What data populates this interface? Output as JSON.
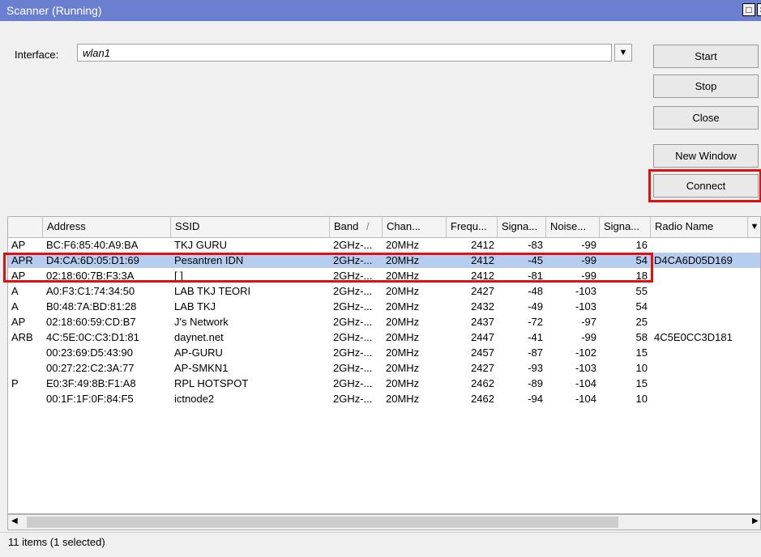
{
  "window": {
    "title": "Scanner (Running)"
  },
  "interface": {
    "label": "Interface:",
    "value": "wlan1"
  },
  "buttons": {
    "start": "Start",
    "stop": "Stop",
    "close": "Close",
    "new_window": "New Window",
    "connect": "Connect"
  },
  "table": {
    "columns": [
      "",
      "Address",
      "SSID",
      "Band",
      "Chan...",
      "Frequ...",
      "Signa...",
      "Noise...",
      "Signa...",
      "Radio Name"
    ],
    "sort_indicator": "/",
    "rows": [
      {
        "flags": "AP",
        "address": "BC:F6:85:40:A9:BA",
        "ssid": "TKJ GURU",
        "band": "2GHz-...",
        "channel": "20MHz",
        "freq": "2412",
        "signal": "-83",
        "noise": "-99",
        "snr": "16",
        "radio": ""
      },
      {
        "flags": "APR",
        "address": "D4:CA:6D:05:D1:69",
        "ssid": "Pesantren IDN",
        "band": "2GHz-...",
        "channel": "20MHz",
        "freq": "2412",
        "signal": "-45",
        "noise": "-99",
        "snr": "54",
        "radio": "D4CA6D05D169",
        "selected": true
      },
      {
        "flags": "AP",
        "address": "02:18:60:7B:F3:3A",
        "ssid": "[ ]",
        "band": "2GHz-...",
        "channel": "20MHz",
        "freq": "2412",
        "signal": "-81",
        "noise": "-99",
        "snr": "18",
        "radio": ""
      },
      {
        "flags": "A",
        "address": "A0:F3:C1:74:34:50",
        "ssid": "LAB TKJ TEORI",
        "band": "2GHz-...",
        "channel": "20MHz",
        "freq": "2427",
        "signal": "-48",
        "noise": "-103",
        "snr": "55",
        "radio": ""
      },
      {
        "flags": "A",
        "address": "B0:48:7A:BD:81:28",
        "ssid": "LAB TKJ",
        "band": "2GHz-...",
        "channel": "20MHz",
        "freq": "2432",
        "signal": "-49",
        "noise": "-103",
        "snr": "54",
        "radio": ""
      },
      {
        "flags": "AP",
        "address": "02:18:60:59:CD:B7",
        "ssid": "J's Network",
        "band": "2GHz-...",
        "channel": "20MHz",
        "freq": "2437",
        "signal": "-72",
        "noise": "-97",
        "snr": "25",
        "radio": ""
      },
      {
        "flags": "ARB",
        "address": "4C:5E:0C:C3:D1:81",
        "ssid": "daynet.net",
        "band": "2GHz-...",
        "channel": "20MHz",
        "freq": "2447",
        "signal": "-41",
        "noise": "-99",
        "snr": "58",
        "radio": "4C5E0CC3D181"
      },
      {
        "flags": "",
        "address": "00:23:69:D5:43:90",
        "ssid": "AP-GURU",
        "band": "2GHz-...",
        "channel": "20MHz",
        "freq": "2457",
        "signal": "-87",
        "noise": "-102",
        "snr": "15",
        "radio": ""
      },
      {
        "flags": "",
        "address": "00:27:22:C2:3A:77",
        "ssid": "AP-SMKN1",
        "band": "2GHz-...",
        "channel": "20MHz",
        "freq": "2427",
        "signal": "-93",
        "noise": "-103",
        "snr": "10",
        "radio": ""
      },
      {
        "flags": "P",
        "address": "E0:3F:49:8B:F1:A8",
        "ssid": "RPL HOTSPOT",
        "band": "2GHz-...",
        "channel": "20MHz",
        "freq": "2462",
        "signal": "-89",
        "noise": "-104",
        "snr": "15",
        "radio": ""
      },
      {
        "flags": "",
        "address": "00:1F:1F:0F:84:F5",
        "ssid": "ictnode2",
        "band": "2GHz-...",
        "channel": "20MHz",
        "freq": "2462",
        "signal": "-94",
        "noise": "-104",
        "snr": "10",
        "radio": ""
      }
    ]
  },
  "status": {
    "text": "11 items (1 selected)"
  },
  "colors": {
    "titlebar": "#6b7fd0",
    "selected_row": "#b7cdf0",
    "highlight": "#e01010"
  }
}
